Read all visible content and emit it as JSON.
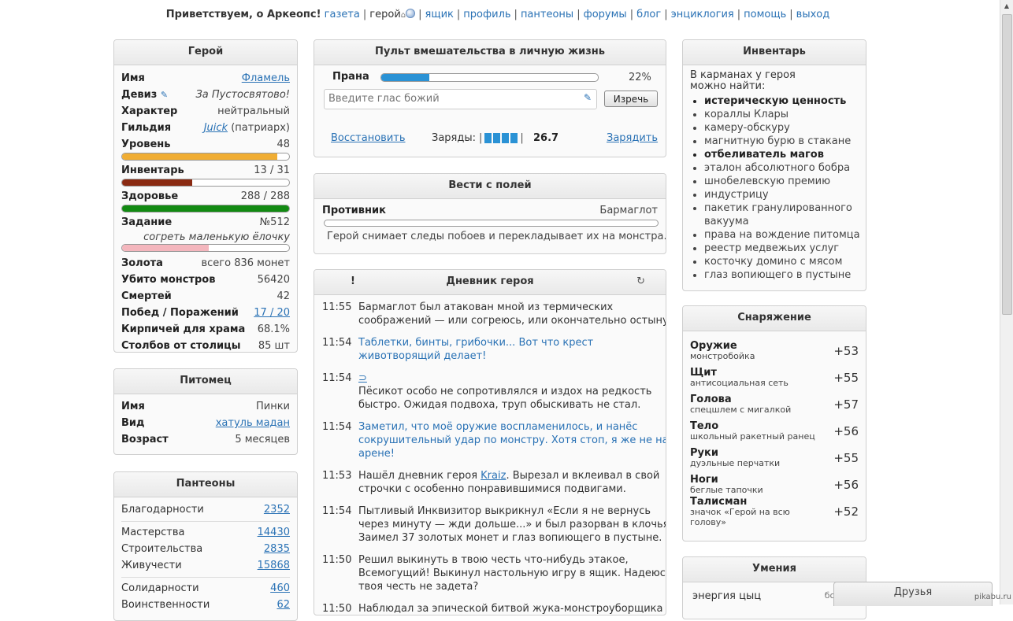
{
  "nav": {
    "greeting": "Приветствуем, о Аркеопс!",
    "items": [
      "газета",
      "герой",
      "ящик",
      "профиль",
      "пантеоны",
      "форумы",
      "блог",
      "энциклогия",
      "помощь",
      "выход"
    ]
  },
  "hero": {
    "title": "Герой",
    "name_label": "Имя",
    "name": "Фламель",
    "motto_label": "Девиз",
    "motto": "За Пустосвятово!",
    "character_label": "Характер",
    "character": "нейтральный",
    "guild_label": "Гильдия",
    "guild": "Juick",
    "guild_rank": "(патриарх)",
    "level_label": "Уровень",
    "level": "48",
    "level_progress": 0.93,
    "inventory_label": "Инвентарь",
    "inventory": "13 / 31",
    "inventory_progress": 0.42,
    "health_label": "Здоровье",
    "health": "288 / 288",
    "health_progress": 1.0,
    "quest_label": "Задание",
    "quest_number": "№512",
    "quest_text": "согреть маленькую ёлочку",
    "quest_progress": 0.52,
    "gold_label": "Золота",
    "gold": "всего 836 монет",
    "monsters_label": "Убито монстров",
    "monsters": "56420",
    "deaths_label": "Смертей",
    "deaths": "42",
    "wins_label": "Побед / Поражений",
    "wins": "17 / 20",
    "bricks_label": "Кирпичей для храма",
    "bricks": "68.1%",
    "pillars_label": "Столбов от столицы",
    "pillars": "85 шт"
  },
  "pet": {
    "title": "Питомец",
    "name_label": "Имя",
    "name": "Пинки",
    "kind_label": "Вид",
    "kind": "хатуль мадан",
    "age_label": "Возраст",
    "age": "5 месяцев"
  },
  "pantheons": {
    "title": "Пантеоны",
    "groups": [
      [
        {
          "label": "Благодарности",
          "value": "2352"
        }
      ],
      [
        {
          "label": "Мастерства",
          "value": "14430"
        },
        {
          "label": "Строительства",
          "value": "2835"
        },
        {
          "label": "Живучести",
          "value": "15868"
        }
      ],
      [
        {
          "label": "Солидарности",
          "value": "460"
        },
        {
          "label": "Воинственности",
          "value": "62"
        }
      ]
    ]
  },
  "control": {
    "title": "Пульт вмешательства в личную жизнь",
    "prana_label": "Прана",
    "prana_value": "22%",
    "prana_progress": 0.22,
    "voice_placeholder": "Введите глас божий",
    "say_button": "Изречь",
    "restore_link": "Восстановить",
    "charges_label": "Заряды:",
    "charges_value": "26.7",
    "charges_count": 4,
    "charge_link": "Зарядить"
  },
  "news": {
    "title": "Вести с полей",
    "enemy_label": "Противник",
    "enemy_name": "Бармаглот",
    "text": "Герой снимает следы побоев и перекладывает их на монстра..."
  },
  "diary": {
    "title": "Дневник героя",
    "left_icon": "!",
    "entries": [
      {
        "time": "11:55",
        "lines": [
          "Бармаглот был атакован мной из термических",
          "соображений — или согреюсь, или окончательно остыну."
        ],
        "voice": false
      },
      {
        "time": "11:54",
        "lines": [
          "Таблетки, бинты, грибочки... Вот что крест",
          "животворящий делает!"
        ],
        "voice": true
      },
      {
        "time": "11:54",
        "prefix": "⊃",
        "lines": [
          " Пёсикот особо не сопротивлялся и издох на редкость",
          "быстро. Ожидая подвоха, труп обыскивать не стал."
        ],
        "voice": false
      },
      {
        "time": "11:54",
        "lines": [
          "Заметил, что моё оружие воспламенилось, и нанёс",
          "сокрушительный удар по монстру. Хотя стоп, я же не на",
          "арене!"
        ],
        "voice": true
      },
      {
        "time": "11:53",
        "pre": "Нашёл дневник героя ",
        "link": "Kraiz",
        "post": ". Вырезал и вклеивал в свой",
        "lines": [
          "строчки с особенно понравившимися подвигами."
        ],
        "voice": false
      },
      {
        "time": "11:54",
        "lines": [
          "Пытливый Инквизитор выкрикнул «Если я не вернусь",
          "через минуту — жди дольше...» и был разорван в клочья.",
          "Заимел 37 золотых монет и глаз вопиющего в пустыне."
        ],
        "voice": false
      },
      {
        "time": "11:50",
        "lines": [
          "Решил выкинуть в твою честь что-нибудь этакое,",
          "Всемогущий! Выкинул настольную игру в ящик. Надеюсь,",
          "твоя честь не задета?"
        ],
        "voice": false
      },
      {
        "time": "11:50",
        "lines": [
          "Наблюдал за эпической битвой жука-монстроуборщика"
        ],
        "voice": false
      }
    ]
  },
  "inventory": {
    "title": "Инвентарь",
    "intro": "В карманах у героя можно найти:",
    "items": [
      {
        "text": "истерическую ценность",
        "bold": true
      },
      {
        "text": "кораллы Клары",
        "bold": false
      },
      {
        "text": "камеру-обскуру",
        "bold": false
      },
      {
        "text": "магнитную бурю в стакане",
        "bold": false
      },
      {
        "text": "отбеливатель магов",
        "bold": true
      },
      {
        "text": "эталон абсолютного бобра",
        "bold": false
      },
      {
        "text": "шнобелевскую премию",
        "bold": false
      },
      {
        "text": "индустрицу",
        "bold": false
      },
      {
        "text": "пакетик гранулированного вакуума",
        "bold": false
      },
      {
        "text": "права на вождение питомца",
        "bold": false
      },
      {
        "text": "реестр медвежьих услуг",
        "bold": false
      },
      {
        "text": "косточку домино с мясом",
        "bold": false
      },
      {
        "text": "глаз вопиющего в пустыне",
        "bold": false
      }
    ]
  },
  "equipment": {
    "title": "Снаряжение",
    "items": [
      {
        "slot": "Оружие",
        "name": "монстробойка",
        "bonus": "+53"
      },
      {
        "slot": "Щит",
        "name": "антисоциальная сеть",
        "bonus": "+55"
      },
      {
        "slot": "Голова",
        "name": "спецшлем с мигалкой",
        "bonus": "+57"
      },
      {
        "slot": "Тело",
        "name": "школьный ракетный ранец",
        "bonus": "+56"
      },
      {
        "slot": "Руки",
        "name": "дуэльные перчатки",
        "bonus": "+55"
      },
      {
        "slot": "Ноги",
        "name": "беглые тапочки",
        "bonus": "+56"
      },
      {
        "slot": "Талисман",
        "name": "значок «Герой на всю голову»",
        "bonus": "+52"
      }
    ]
  },
  "skills": {
    "title": "Умения",
    "first_name": "энергия цыц",
    "first_type": "боевое"
  },
  "friends_label": "Друзья",
  "watermark": "pikabu.ru",
  "colors": {
    "link": "#2a72b5",
    "level_bar": "#f0ad33",
    "inventory_bar": "#8a2a12",
    "health_bar": "#128a12",
    "quest_bar": "#f4b6bd",
    "prana_bar": "#2a92d5",
    "charge_cell": "#2a92d5"
  }
}
